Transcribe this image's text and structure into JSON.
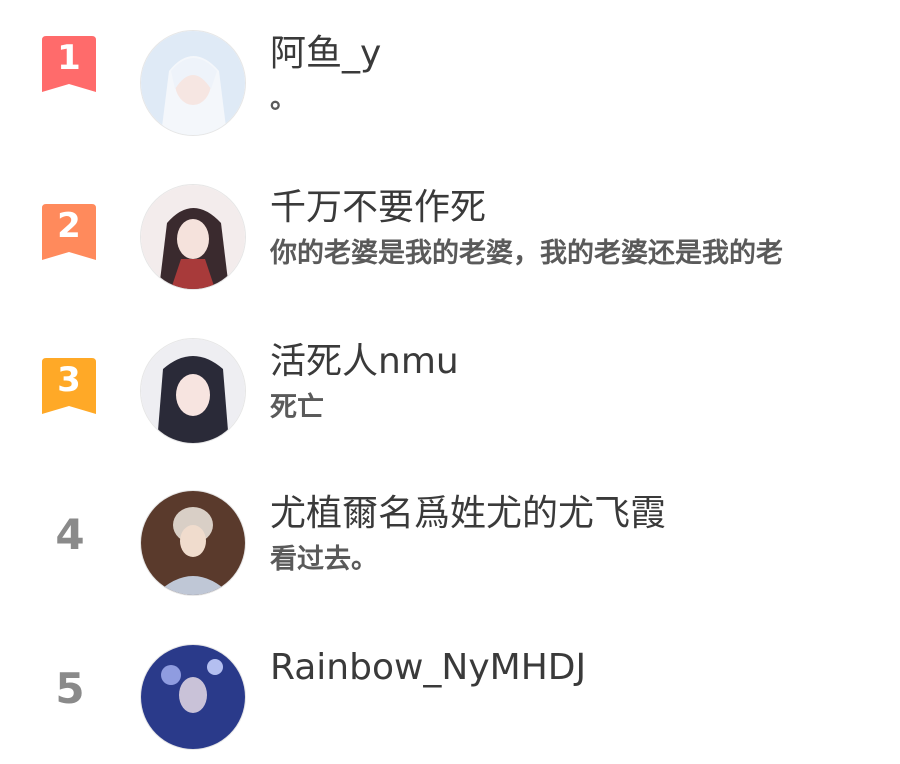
{
  "ranking": [
    {
      "rank": "1",
      "name": "阿鱼_y",
      "signature": "。",
      "badge_color": "#ff6b6b"
    },
    {
      "rank": "2",
      "name": "千万不要作死",
      "signature": "你的老婆是我的老婆，我的老婆还是我的老",
      "badge_color": "#ff8a5c"
    },
    {
      "rank": "3",
      "name": "活死人nmu",
      "signature": "死亡",
      "badge_color": "#ffa927"
    },
    {
      "rank": "4",
      "name": "尤植爾名爲姓尤的尤飞霞",
      "signature": "看过去。"
    },
    {
      "rank": "5",
      "name": "Rainbow_NyMHDJ",
      "signature": ""
    }
  ]
}
